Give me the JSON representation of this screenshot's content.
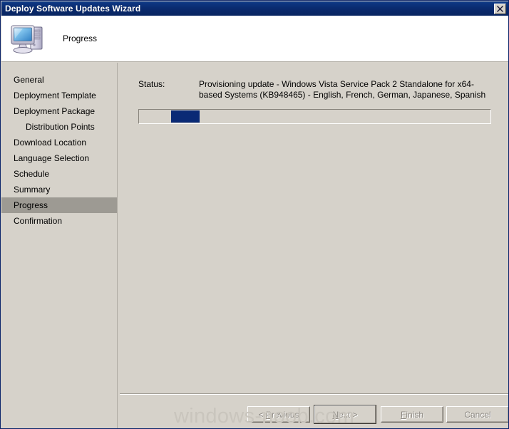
{
  "window": {
    "title": "Deploy Software Updates Wizard",
    "close_icon": "close-icon"
  },
  "header": {
    "icon": "computer-icon",
    "title": "Progress"
  },
  "sidebar": {
    "items": [
      {
        "label": "General",
        "selected": false,
        "indented": false
      },
      {
        "label": "Deployment Template",
        "selected": false,
        "indented": false
      },
      {
        "label": "Deployment Package",
        "selected": false,
        "indented": false
      },
      {
        "label": "Distribution Points",
        "selected": false,
        "indented": true
      },
      {
        "label": "Download Location",
        "selected": false,
        "indented": false
      },
      {
        "label": "Language Selection",
        "selected": false,
        "indented": false
      },
      {
        "label": "Schedule",
        "selected": false,
        "indented": false
      },
      {
        "label": "Summary",
        "selected": false,
        "indented": false
      },
      {
        "label": "Progress",
        "selected": true,
        "indented": false
      },
      {
        "label": "Confirmation",
        "selected": false,
        "indented": false
      }
    ]
  },
  "content": {
    "status_label": "Status:",
    "status_value": "Provisioning update - Windows Vista Service Pack 2 Standalone for x64-based Systems (KB948465) - English, French, German, Japanese, Spanish",
    "progress": {
      "style": "marquee",
      "chunk_position_percent": 9,
      "chunk_width_percent": 8
    }
  },
  "footer": {
    "buttons": [
      {
        "id": "previous",
        "label": "< Previous",
        "enabled": false,
        "default": false
      },
      {
        "id": "next",
        "label": "Next >",
        "enabled": false,
        "default": true
      },
      {
        "id": "finish",
        "label": "Finish",
        "enabled": false,
        "default": false
      },
      {
        "id": "cancel",
        "label": "Cancel",
        "enabled": false,
        "default": false
      }
    ]
  },
  "watermark": {
    "text": "windows-noob.com"
  },
  "colors": {
    "titlebar": "#0a2a6e",
    "body": "#d6d2ca",
    "selection": "#9d9a93",
    "progress_chunk": "#0a2a75",
    "disabled_text": "#8b8781",
    "watermark": "#c9c5bd"
  }
}
